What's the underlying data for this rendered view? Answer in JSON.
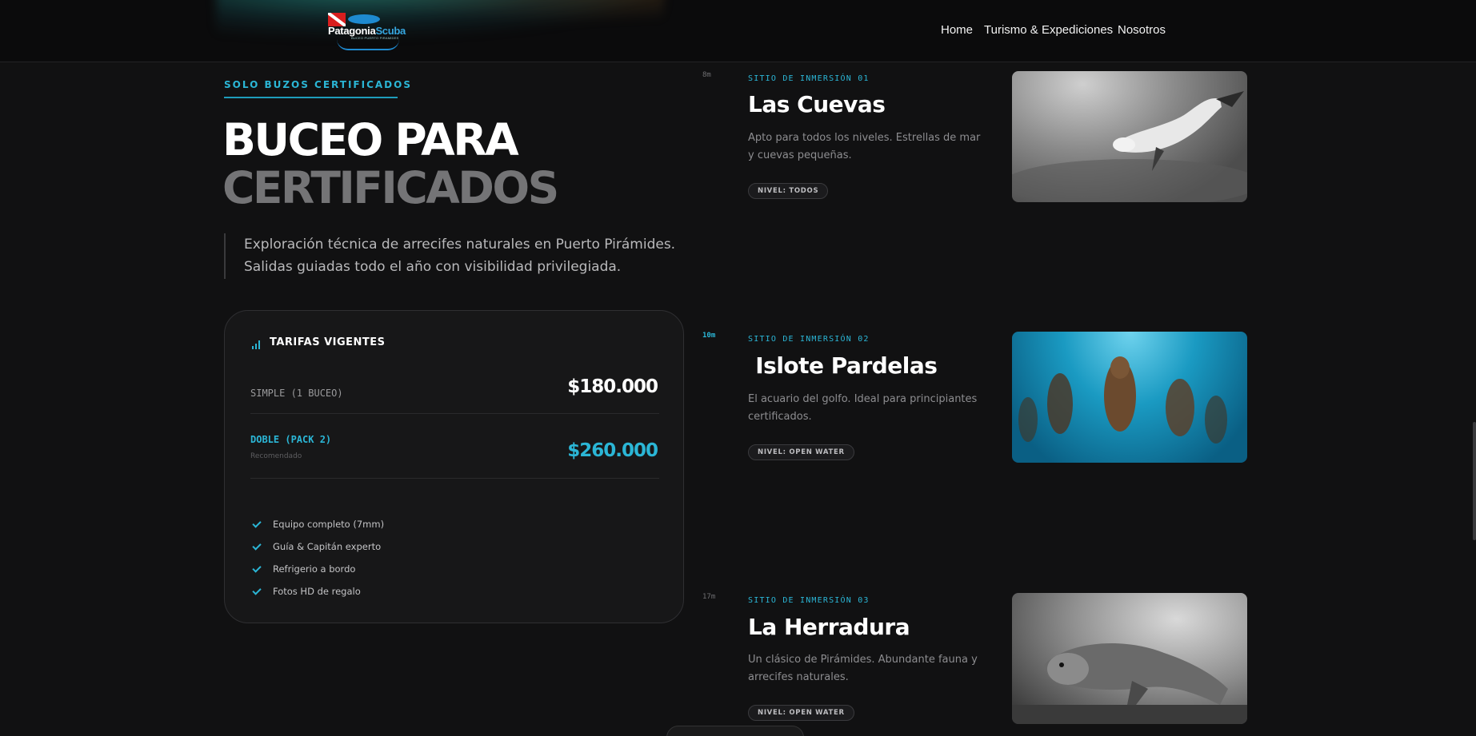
{
  "header": {
    "logo": {
      "brand_part1": "Patagonia",
      "brand_part2": "Scuba",
      "tagline": "BUCEO PUERTO PIRAMIDES"
    },
    "nav": {
      "home": "Home",
      "tours": "Turismo & Expediciones",
      "about": "Nosotros"
    }
  },
  "hero": {
    "eyebrow": "SOLO BUZOS CERTIFICADOS",
    "title_line1": "BUCEO PARA",
    "title_line2": "CERTIFICADOS",
    "description": "Exploración técnica de arrecifes naturales en Puerto Pirámides. Salidas guiadas todo el año con visibilidad privilegiada."
  },
  "pricing": {
    "title": "TARIFAS VIGENTES",
    "icon": "bar-chart-icon",
    "rows": [
      {
        "label": "SIMPLE (1 BUCEO)",
        "price": "$180.000",
        "note": ""
      },
      {
        "label": "DOBLE (PACK 2)",
        "price": "$260.000",
        "note": "Recomendado"
      }
    ],
    "features": [
      "Equipo completo (7mm)",
      "Guía & Capitán experto",
      "Refrigerio a bordo",
      "Fotos HD de regalo"
    ]
  },
  "sites": [
    {
      "depth": "8m",
      "kicker": "SITIO DE INMERSIÓN 01",
      "name": "Las Cuevas",
      "desc": "Apto para todos los niveles. Estrellas de mar y cuevas pequeñas.",
      "level": "NIVEL: TODOS"
    },
    {
      "depth": "10m",
      "kicker": "SITIO DE INMERSIÓN 02",
      "name": " Islote Pardelas",
      "desc": "El acuario del golfo. Ideal para principiantes certificados.",
      "level": "NIVEL: OPEN WATER"
    },
    {
      "depth": "17m",
      "kicker": "SITIO DE INMERSIÓN 03",
      "name": "La Herradura",
      "desc": "Un clásico de Pirámides. Abundante fauna y arrecifes naturales.",
      "level": "NIVEL: OPEN WATER"
    }
  ],
  "colors": {
    "accent": "#2bb6d6",
    "background": "#111112",
    "card": "#171718"
  }
}
